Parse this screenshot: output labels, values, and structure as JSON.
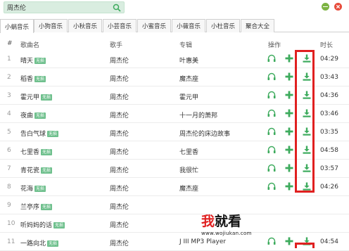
{
  "search": {
    "value": "周杰伦"
  },
  "window": {
    "minimize_color": "#7cb342",
    "close_color": "#e74c3c"
  },
  "tabs": [
    {
      "label": "小蜗音乐"
    },
    {
      "label": "小狗音乐"
    },
    {
      "label": "小秋音乐"
    },
    {
      "label": "小芸音乐"
    },
    {
      "label": "小蜜音乐"
    },
    {
      "label": "小薇音乐"
    },
    {
      "label": "小杜音乐"
    },
    {
      "label": "聚合大全"
    }
  ],
  "columns": {
    "num": "#",
    "song": "歌曲名",
    "artist": "歌手",
    "album": "专辑",
    "ops": "操作",
    "duration": "时长"
  },
  "rows": [
    {
      "num": "1",
      "song": "晴天",
      "badge": "无损",
      "artist": "周杰伦",
      "album": "叶惠美",
      "duration": "04:29",
      "ops": true
    },
    {
      "num": "2",
      "song": "稻香",
      "badge": "无损",
      "artist": "周杰伦",
      "album": "魔杰座",
      "duration": "03:43",
      "ops": true
    },
    {
      "num": "3",
      "song": "霍元甲",
      "badge": "无损",
      "artist": "周杰伦",
      "album": "霍元甲",
      "duration": "04:36",
      "ops": true
    },
    {
      "num": "4",
      "song": "夜曲",
      "badge": "无损",
      "artist": "周杰伦",
      "album": "十一月的萧邦",
      "duration": "03:46",
      "ops": true
    },
    {
      "num": "5",
      "song": "告白气球",
      "badge": "无损",
      "artist": "周杰伦",
      "album": "周杰伦的床边故事",
      "duration": "03:35",
      "ops": true
    },
    {
      "num": "6",
      "song": "七里香",
      "badge": "无损",
      "artist": "周杰伦",
      "album": "七里香",
      "duration": "04:58",
      "ops": true
    },
    {
      "num": "7",
      "song": "青花瓷",
      "badge": "无损",
      "artist": "周杰伦",
      "album": "我很忙",
      "duration": "03:57",
      "ops": true
    },
    {
      "num": "8",
      "song": "花海",
      "badge": "无损",
      "artist": "周杰伦",
      "album": "魔杰座",
      "duration": "04:26",
      "ops": true
    },
    {
      "num": "9",
      "song": "兰亭序",
      "badge": "无损",
      "artist": "周杰伦",
      "album": "",
      "duration": "",
      "ops": false
    },
    {
      "num": "10",
      "song": "听妈妈的话",
      "badge": "无损",
      "artist": "周杰伦",
      "album": "",
      "duration": "",
      "ops": false
    },
    {
      "num": "11",
      "song": "一路向北",
      "badge": "无损",
      "artist": "周杰伦",
      "album": "J III MP3 Player",
      "duration": "04:54",
      "ops": true
    }
  ],
  "watermark": {
    "char1": "我",
    "rest": "就看",
    "url": "www.wojiukan.com"
  },
  "colors": {
    "accent": "#3dab5d",
    "highlight": "#e02020",
    "badge": "#6fc08d"
  },
  "icons": {
    "listen": "headphones-icon",
    "add": "plus-icon",
    "download": "download-icon",
    "search": "search-icon"
  }
}
